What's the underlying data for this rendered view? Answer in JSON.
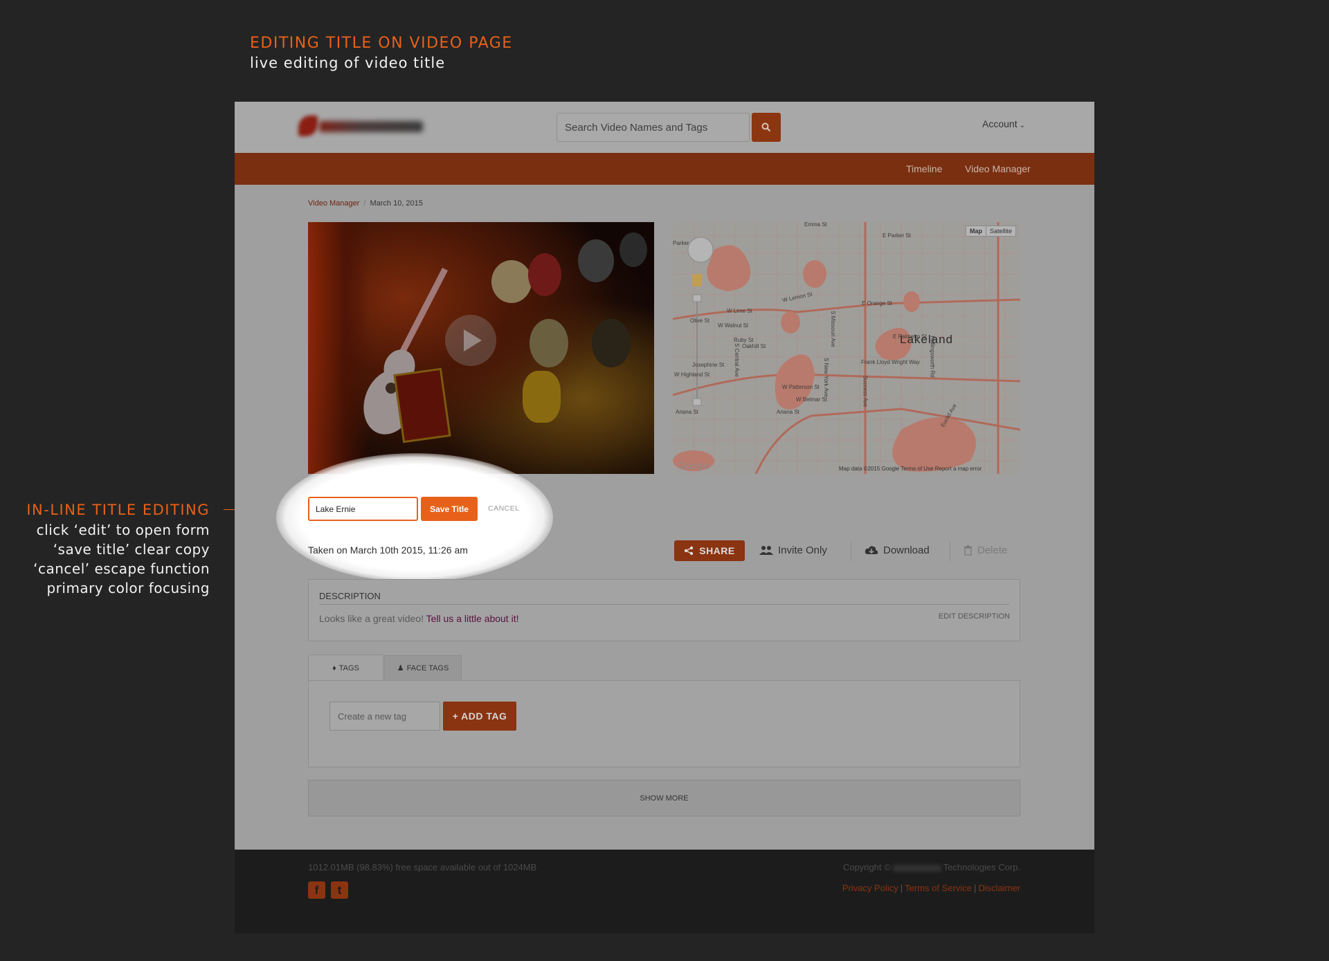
{
  "annotations": {
    "top": {
      "heading": "EDITING TITLE ON VIDEO PAGE",
      "subheading": "live editing of video title"
    },
    "left": {
      "heading": "IN-LINE TITLE EDITING",
      "lines": [
        "click ‘edit’ to open form",
        "‘save title’ clear copy",
        "‘cancel’ escape function",
        "primary color focusing"
      ]
    }
  },
  "header": {
    "search": {
      "placeholder": "Search Video Names and Tags",
      "button_icon": "search-icon"
    },
    "account": "Account"
  },
  "nav": {
    "items": [
      "Timeline",
      "Video Manager"
    ]
  },
  "breadcrumb": {
    "link": "Video Manager",
    "separator": "/",
    "current": "March 10, 2015"
  },
  "map": {
    "city": "Lakeland",
    "toggle": [
      "Map",
      "Satellite"
    ],
    "streets": [
      "E Parker St",
      "W Lemon St",
      "E Orange St",
      "W Lime St",
      "Olive St",
      "W Walnut St",
      "Ruby St",
      "Oakhill St",
      "E Palmetto St",
      "Frank Lloyd Wright Way",
      "Josephine St",
      "W Highland St",
      "W Patterson St",
      "W Belmar St",
      "Ariana St",
      "Ariana St",
      "S Missouri Ave",
      "S New York Ave",
      "S Central Ave",
      "Hollingsworth Rd",
      "Success Ave",
      "Euclid Ave",
      "Emma St",
      "Parker"
    ],
    "footer": "Map data ©2015 Google   Terms of Use   Report a map error",
    "google": "Google"
  },
  "title_edit": {
    "value": "Lake Ernie",
    "save_label": "Save Title",
    "cancel_label": "CANCEL"
  },
  "meta": {
    "taken": "Taken on March 10th 2015, 11:26 am"
  },
  "actions": {
    "share": "SHARE",
    "privacy": "Invite Only",
    "download": "Download",
    "delete": "Delete"
  },
  "description": {
    "heading": "DESCRIPTION",
    "text": "Looks like a great video!",
    "cta": "Tell us a little about it!",
    "edit_label": "EDIT DESCRIPTION"
  },
  "tags": {
    "tabs": [
      "TAGS",
      "FACE TAGS"
    ],
    "input_placeholder": "Create a new tag",
    "add_label": "+ ADD TAG"
  },
  "show_more": "SHOW MORE",
  "footer": {
    "storage": "1012.01MB (98.83%) free space available out of 1024MB",
    "copyright_prefix": "Copyright ©",
    "copyright_suffix": "Technologies Corp.",
    "links": [
      "Privacy Policy",
      "Terms of Service",
      "Disclaimer"
    ]
  },
  "colors": {
    "primary": "#e8611a",
    "overlay_primary": "#8a3411",
    "nav_bg": "#7a2f10",
    "page_bg": "#242424"
  }
}
